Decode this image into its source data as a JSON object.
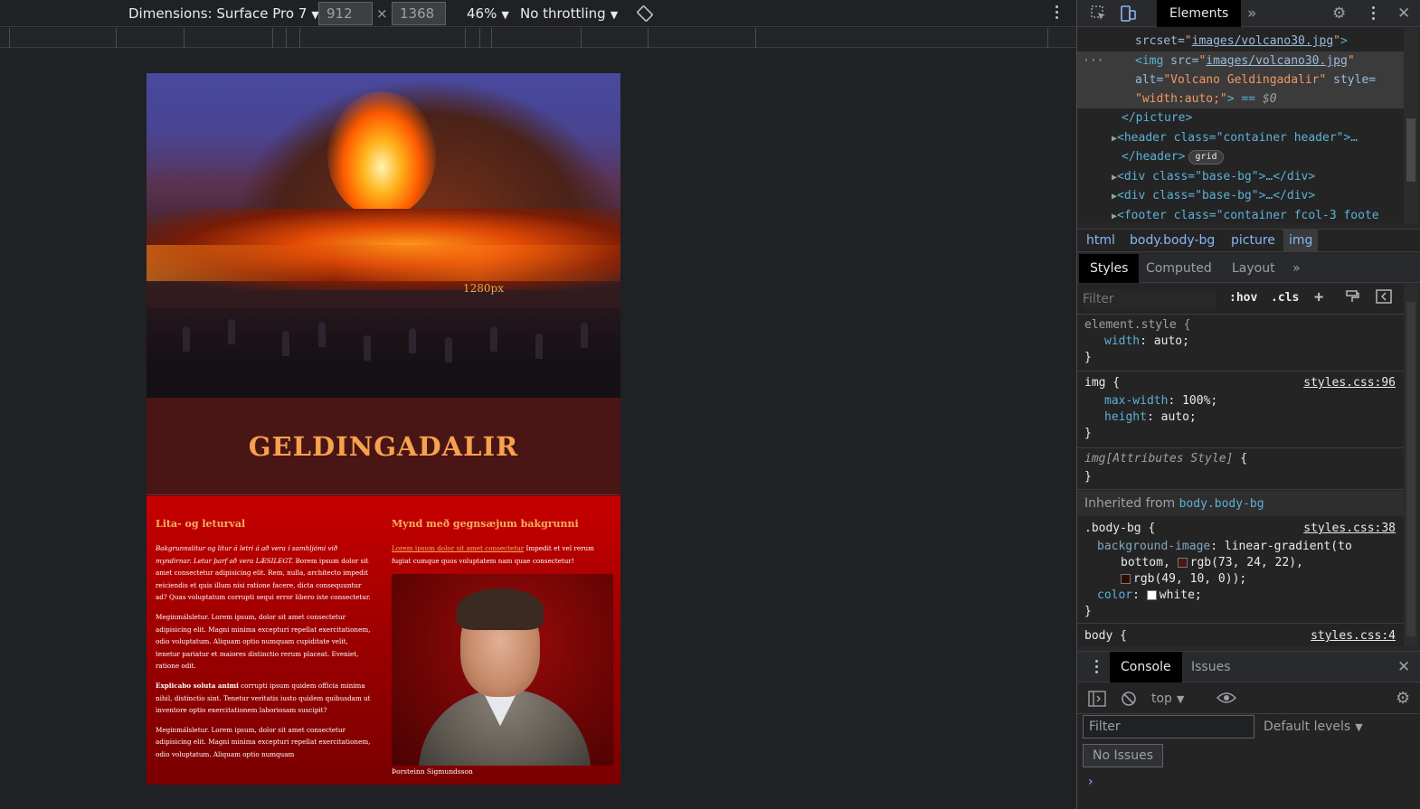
{
  "device_toolbar": {
    "dimensions_label": "Dimensions: Surface Pro 7",
    "width": "912",
    "height": "1368",
    "times": "×",
    "zoom": "46%",
    "throttling": "No throttling"
  },
  "page": {
    "hero_alt": "Volcano Geldingadalir",
    "hero_size_label": "1280px",
    "banner_title": "GELDINGADALIR",
    "left_column": {
      "heading": "Lita- og leturval",
      "p1_italic": "Bakgrunnslitur og litur á letri á að vera í samhljómi við myndirnar. Letur þarf að vera LÆSILEGT.",
      "p1_rest": " Borem ipsum dolor sit amet consectetur adipisicing elit. Rem, nulla, architecto impedit reiciendis et quis illum nisi ratione facere, dicta consequuntur ad? Quas voluptatum corrupti sequi error libero iste consectetur.",
      "p2": "Meginmálsletur. Lorem ipsum, dolor sit amet consectetur adipisicing elit. Magni minima excepturi repellat exercitationem, odio voluptatum. Aliquam optio numquam cupiditate velit, tenetur pariatur et maiores distinctio rerum placeat. Eveniet, ratione odit.",
      "p3_bold": "Explicabo soluta animi",
      "p3_rest": " corrupti ipsum quidem officia minima nihil, distinctio sint. Tenetur veritatis iusto quidem quibusdam ut inventore optio exercitationem laboriosam suscipit?",
      "p4": "Meginmálsletur. Lorem ipsum, dolor sit amet consectetur adipisicing elit. Magni minima excepturi repellat exercitationem, odio voluptatum. Aliquam optio numquam"
    },
    "right_column": {
      "heading": "Mynd með gegnsæjum bakgrunni",
      "link_text": "Lorem ipsum dolor sit amet consectetur",
      "p_rest": " Impedit et vel rerum fugiat cumque quos voluptatem nam quae consectetur!",
      "portrait_caption": "Þorsteinn Sigmundsson"
    }
  },
  "devtools": {
    "tabs": {
      "elements": "Elements",
      "more": "»"
    },
    "dom_lines": {
      "l1_attr": "srcset=",
      "l1_val": "images/volcano30.jpg",
      "l2_tag_open": "<img ",
      "l2_attr": "src=",
      "l2_val": "images/volcano30.jpg",
      "l3_attr1": "alt=",
      "l3_val1": "\"Volcano Geldingadalir\"",
      "l3_attr2": " style=",
      "l4_val": "\"width:auto;\"",
      "l4_rest": "> == ",
      "l4_ref": "$0",
      "l5": "</picture>",
      "l6": "<header class=\"container header\">…",
      "l7": "</header>",
      "l7_badge": "grid",
      "l8": "<div class=\"base-bg\">…</div>",
      "l9": "<div class=\"base-bg\">…</div>",
      "l10": "<footer class=\"container fcol-3 foote"
    },
    "breadcrumbs": [
      "html",
      "body.body-bg",
      "picture",
      "img"
    ],
    "style_tabs": {
      "styles": "Styles",
      "computed": "Computed",
      "layout": "Layout",
      "more": "»"
    },
    "filter_placeholder": "Filter",
    "hov": ":hov",
    "cls": ".cls",
    "rules": {
      "element_style_selector": "element.style {",
      "element_style_prop": "width",
      "element_style_val": "auto;",
      "img_selector": "img {",
      "img_src": "styles.css:96",
      "img_prop1": "max-width",
      "img_val1": "100%;",
      "img_prop2": "height",
      "img_val2": "auto;",
      "attr_selector": "img[Attributes Style]",
      "attr_brace": " {",
      "inherited_label": "Inherited from ",
      "inherited_target": "body.body-bg",
      "bodybg_selector": ".body-bg {",
      "bodybg_src": "styles.css:38",
      "bodybg_prop1": "background-image",
      "bodybg_val1a": "linear-gradient(to",
      "bodybg_val1b": "bottom, ",
      "bodybg_color1": "rgb(73, 24, 22),",
      "bodybg_color2": "rgb(49, 10, 0));",
      "bodybg_prop2": "color",
      "bodybg_val2": "white;",
      "body_selector": "body {",
      "body_src": "styles.css:4",
      "close_brace": "}"
    },
    "drawer": {
      "console": "Console",
      "issues": "Issues",
      "context": "top",
      "filter_placeholder": "Filter",
      "levels": "Default levels",
      "no_issues": "No Issues",
      "prompt": "›"
    }
  },
  "colors": {
    "banner_title": "#f6a24e",
    "heading_accent": "#f8b060",
    "swatch_1": "#491816",
    "swatch_2": "#310a00"
  }
}
